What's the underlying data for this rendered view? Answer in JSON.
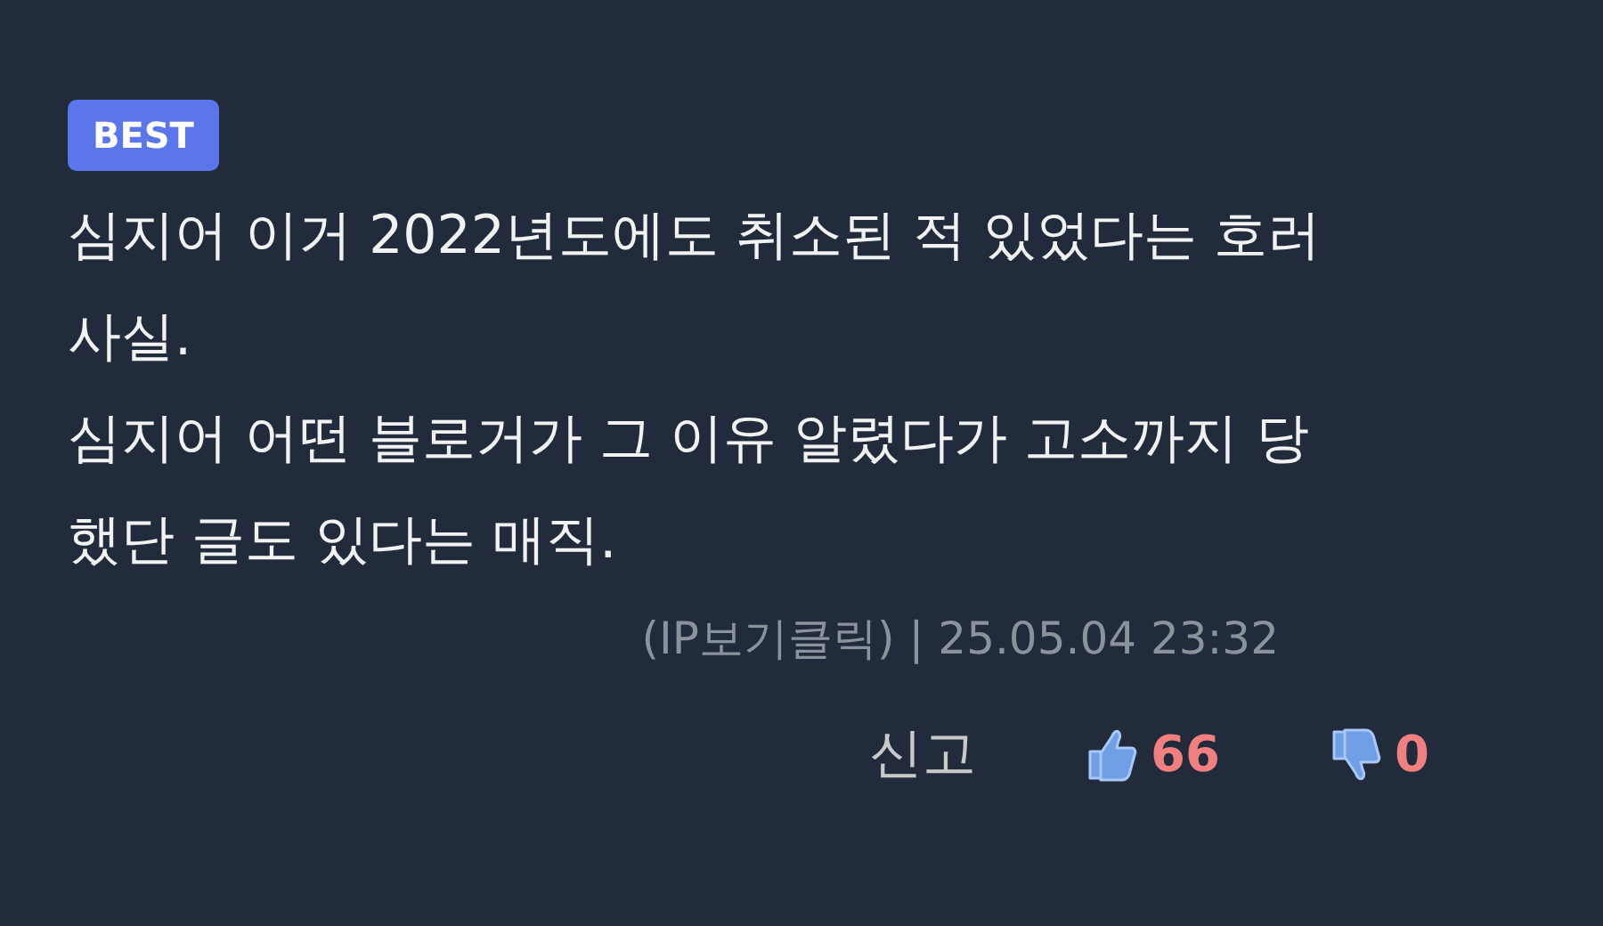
{
  "comment": {
    "badge": "BEST",
    "paragraphs": [
      {
        "lines": [
          "심지어 이거 2022년도에도 취소된 적 있었다는 호러",
          "사실."
        ]
      },
      {
        "lines": [
          "심지어 어떤 블로거가 그 이유 알렸다가 고소까지 당",
          "했단 글도 있다는 매직."
        ]
      }
    ],
    "ip_link": "(IP보기클릭)",
    "separator": "|",
    "timestamp": "25.05.04 23:32",
    "report": "신고",
    "likes": "66",
    "dislikes": "0"
  }
}
